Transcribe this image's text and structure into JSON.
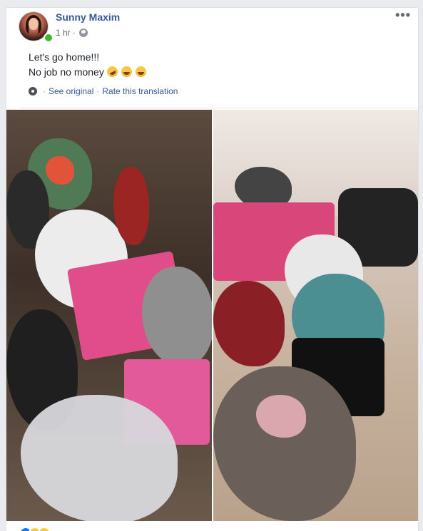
{
  "post": {
    "author": "Sunny Maxim",
    "timestamp": "1 hr",
    "meta_separator": "·",
    "privacy_icon": "globe-icon",
    "more_icon": "more-options-icon",
    "more_glyph": "•••",
    "text_line1": "Let's go home!!!",
    "text_line2": "No job no money",
    "emojis": [
      "rolling-on-floor-laughing",
      "grinning-sweat",
      "tears-of-joy"
    ],
    "translation": {
      "icon": "gear-icon",
      "separator": "·",
      "see_original": "See original",
      "rate": "Rate this translation"
    },
    "photos": [
      {
        "name": "photo-bags-left",
        "description_icon": "photo"
      },
      {
        "name": "photo-bags-right",
        "description_icon": "photo"
      }
    ],
    "reactions": [
      "like",
      "haha",
      "haha"
    ]
  },
  "colors": {
    "link": "#385898",
    "text": "#1d2129",
    "meta": "#616770",
    "online": "#42b72a",
    "background": "#e9ebee"
  }
}
